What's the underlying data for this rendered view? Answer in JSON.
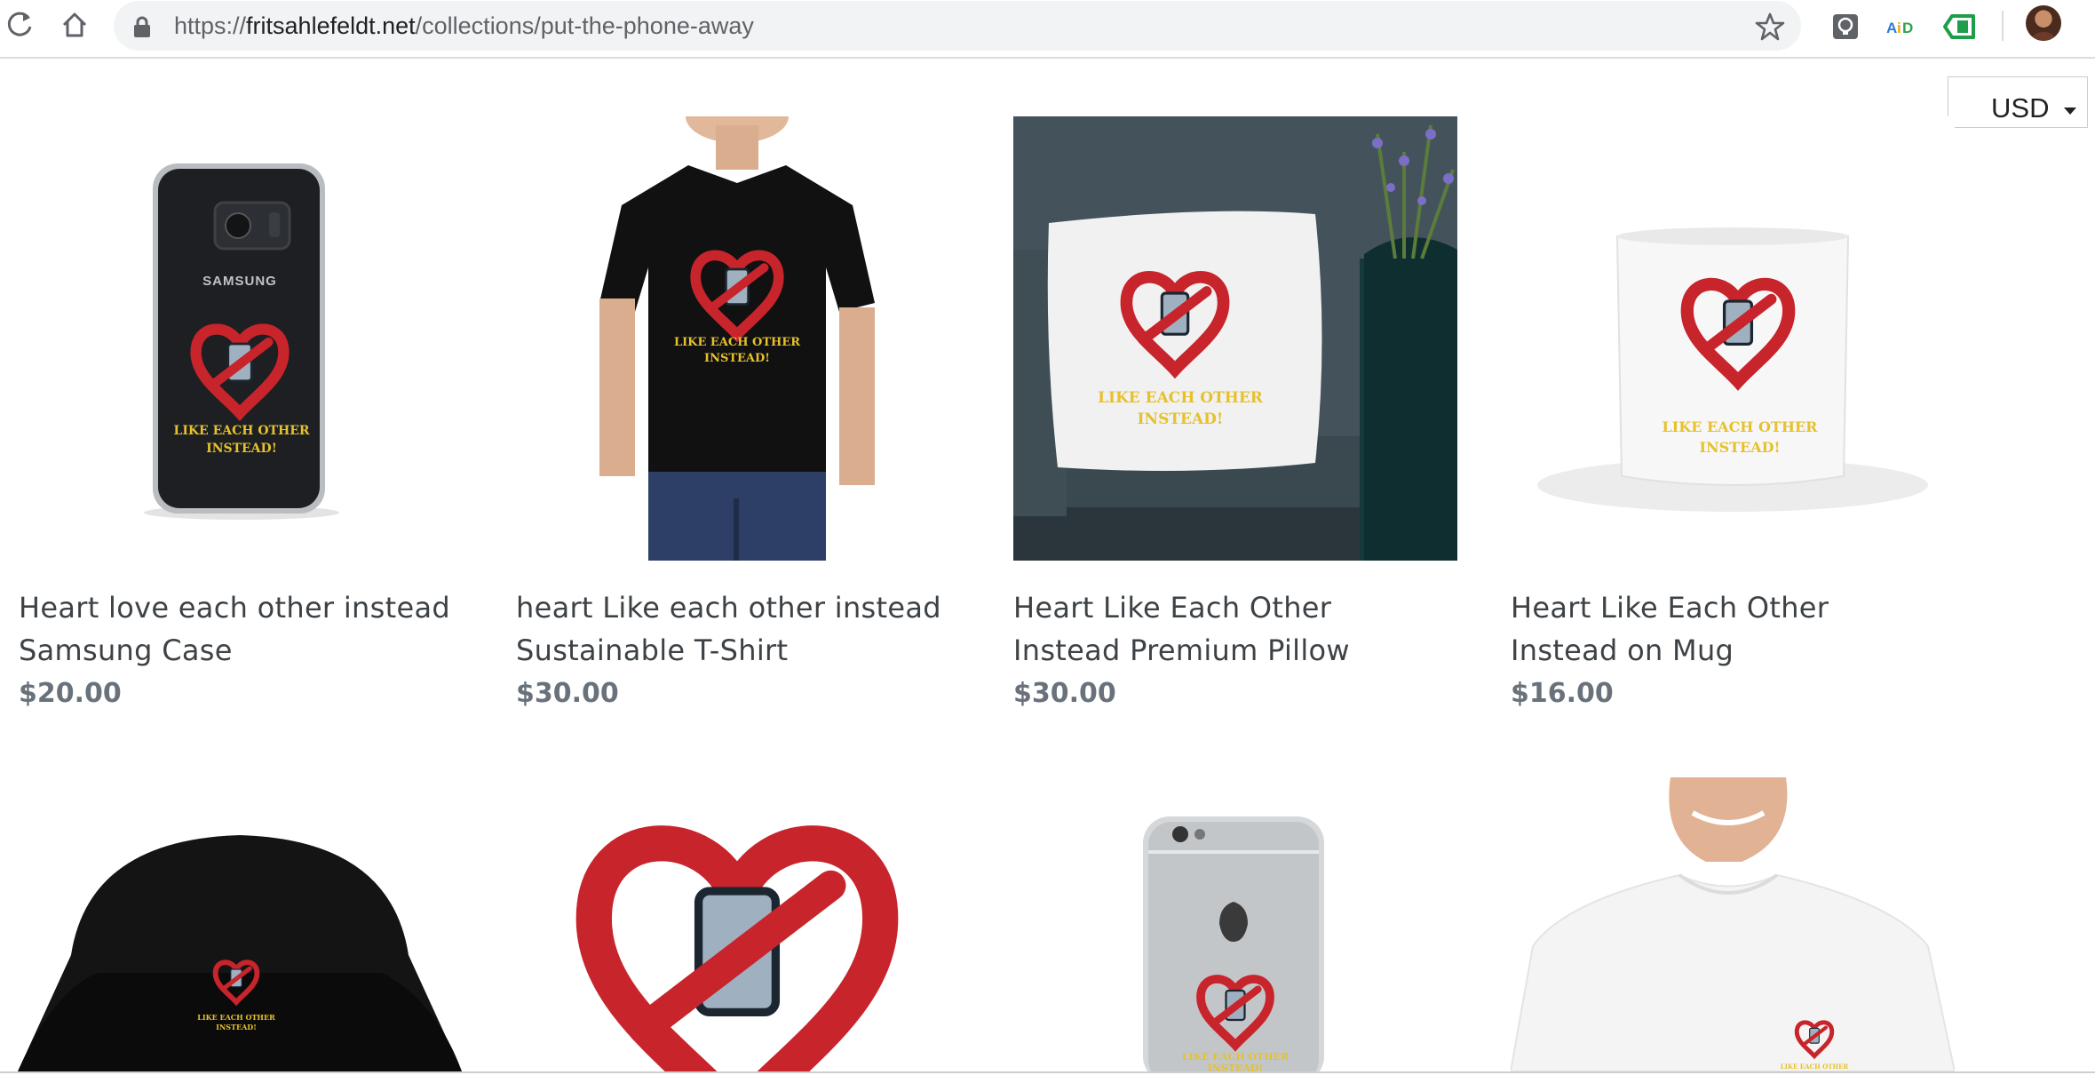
{
  "browser": {
    "url_scheme": "https://",
    "url_host": "fritsahlefeldt.net",
    "url_path": "/collections/put-the-phone-away",
    "extensions": [
      "lightbulb-extension-icon",
      "aid-extension-icon",
      "green-tag-extension-icon"
    ],
    "icons": {
      "reload": "reload-icon",
      "home": "home-icon",
      "lock": "lock-icon",
      "bookmark": "star-icon",
      "profile": "avatar"
    }
  },
  "currency": {
    "selected": "USD"
  },
  "products": [
    {
      "title": "Heart love each other instead Samsung Case",
      "price": "$20.00",
      "image": "samsung-case-image"
    },
    {
      "title": "heart Like each other instead Sustainable T-Shirt",
      "price": "$30.00",
      "image": "black-tshirt-image"
    },
    {
      "title": "Heart Like Each Other Instead Premium Pillow",
      "price": "$30.00",
      "image": "pillow-image"
    },
    {
      "title": "Heart Like Each Other Instead on Mug",
      "price": "$16.00",
      "image": "mug-image"
    },
    {
      "image": "bucket-hat-image"
    },
    {
      "image": "heart-sticker-image"
    },
    {
      "image": "iphone-case-image"
    },
    {
      "image": "white-tshirt-image"
    }
  ],
  "colors": {
    "title": "#3d4246",
    "price": "#69727b",
    "heart_red": "#c8242b",
    "lettering_yellow": "#e6c12d"
  }
}
